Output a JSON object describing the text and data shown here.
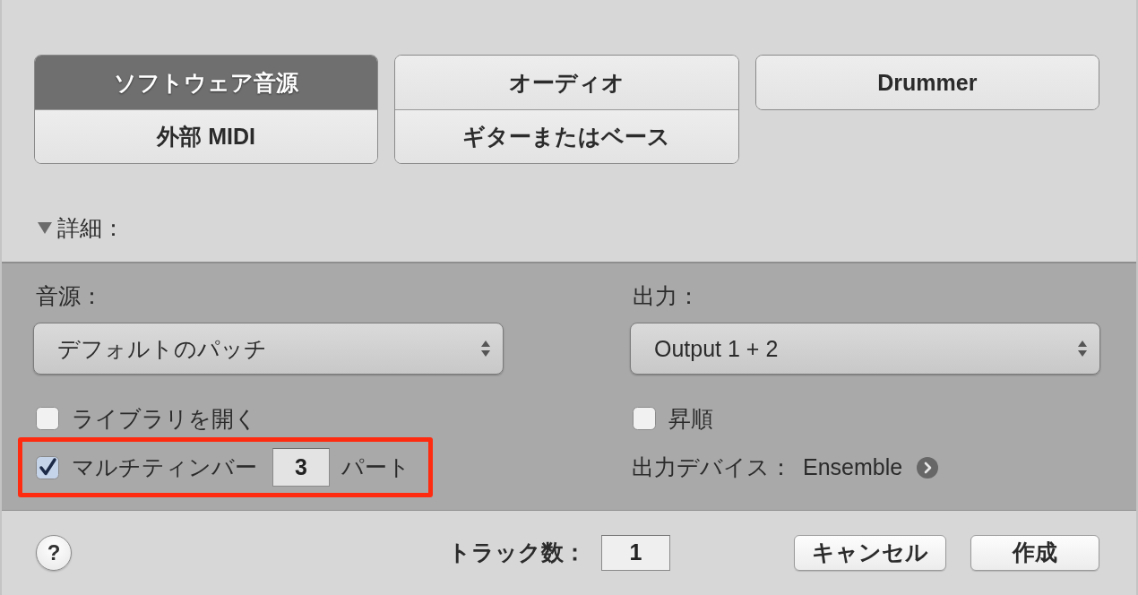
{
  "track_type_groups": [
    {
      "options": [
        {
          "label": "ソフトウェア音源",
          "selected": true
        },
        {
          "label": "外部 MIDI",
          "selected": false
        }
      ]
    },
    {
      "options": [
        {
          "label": "オーディオ",
          "selected": false
        },
        {
          "label": "ギターまたはベース",
          "selected": false
        }
      ]
    },
    {
      "options": [
        {
          "label": "Drummer",
          "selected": false
        }
      ]
    }
  ],
  "details": {
    "label": "詳細：",
    "expanded": true,
    "instrument": {
      "label": "音源：",
      "popup": "デフォルトのパッチ",
      "open_library": {
        "label": "ライブラリを開く",
        "checked": false
      },
      "multitimbral": {
        "label": "マルチティンバー",
        "checked": true,
        "parts": "3",
        "unit": "パート",
        "highlighted": true
      }
    },
    "output": {
      "label": "出力：",
      "popup": "Output 1 + 2",
      "ascending": {
        "label": "昇順",
        "checked": false
      },
      "device": {
        "label": "出力デバイス：",
        "value": "Ensemble"
      }
    }
  },
  "footer": {
    "help_button": "?",
    "track_count": {
      "label": "トラック数：",
      "value": "1"
    },
    "buttons": [
      {
        "label": "キャンセル"
      },
      {
        "label": "作成"
      }
    ]
  }
}
